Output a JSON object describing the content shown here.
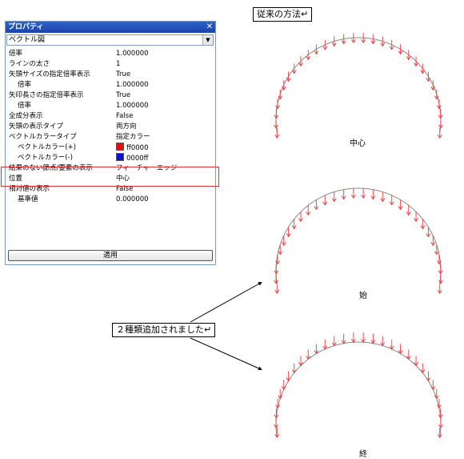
{
  "panel": {
    "title": "プロパティ",
    "object": "ベクトル図",
    "apply_label": "適用"
  },
  "properties": [
    {
      "name": "倍率",
      "value": "1.000000",
      "indent": false
    },
    {
      "name": "ラインの太さ",
      "value": "1",
      "indent": false
    },
    {
      "name": "矢頭サイズの指定倍率表示",
      "value": "True",
      "indent": false
    },
    {
      "name": "倍率",
      "value": "1.000000",
      "indent": true
    },
    {
      "name": "矢印長さの指定倍率表示",
      "value": "True",
      "indent": false
    },
    {
      "name": "倍率",
      "value": "1.000000",
      "indent": true
    },
    {
      "name": "全成分表示",
      "value": "False",
      "indent": false
    },
    {
      "name": "矢頭の表示タイプ",
      "value": "両方向",
      "indent": false
    },
    {
      "name": "ベクトルカラータイプ",
      "value": "指定カラー",
      "indent": false
    },
    {
      "name": "ベクトルカラー(+)",
      "value": "ff0000",
      "indent": true,
      "swatch": "#e41010"
    },
    {
      "name": "ベクトルカラー(-)",
      "value": "0000ff",
      "indent": true,
      "swatch": "#1010d0"
    },
    {
      "name": "結果のない節点/要素の表示",
      "value": "フィーチャーエッジ",
      "indent": false
    },
    {
      "name": "位置",
      "value": "中心",
      "indent": false
    },
    {
      "name": "相対値の表示",
      "value": "False",
      "indent": false
    },
    {
      "name": "基準値",
      "value": "0.000000",
      "indent": true
    }
  ],
  "annotations": {
    "conventional": "従来の方法↵",
    "added": "２種類追加されました↵"
  },
  "figures": [
    {
      "label": "中心"
    },
    {
      "label": "始"
    },
    {
      "label": "終"
    }
  ],
  "colors": {
    "arrow": "#e83a3a",
    "arc": "#888888",
    "highlight": "#d93030"
  }
}
